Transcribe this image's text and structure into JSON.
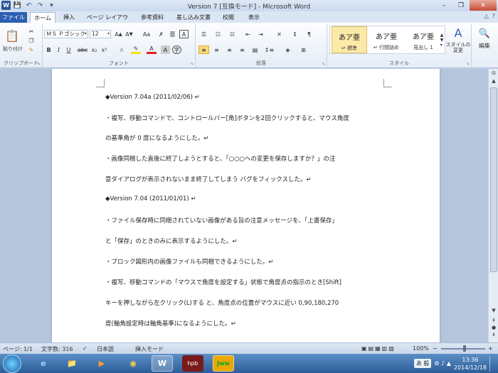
{
  "window": {
    "title": "Version 7 [互換モード] - Microsoft Word",
    "min_label": "–",
    "max_label": "❐",
    "close_label": "✕"
  },
  "tabs": [
    {
      "label": "ファイル"
    },
    {
      "label": "ホーム"
    },
    {
      "label": "挿入"
    },
    {
      "label": "ページ レイアウト"
    },
    {
      "label": "参考資料"
    },
    {
      "label": "差し込み文書"
    },
    {
      "label": "校閲"
    },
    {
      "label": "表示"
    }
  ],
  "ribbon": {
    "clipboard": {
      "label": "クリップボード",
      "paste_label": "貼り付け"
    },
    "font": {
      "label": "フォント",
      "font_name": "ＭＳ Ｐゴシック",
      "font_size": "12"
    },
    "paragraph": {
      "label": "段落"
    },
    "styles": {
      "label": "スタイル",
      "items": [
        {
          "sample": "あア亜",
          "name": "↵ 標準"
        },
        {
          "sample": "あア亜",
          "name": "↵ 行間詰め"
        },
        {
          "sample": "あア亜",
          "name": "見出し 1"
        }
      ],
      "change_label": "スタイルの変更"
    },
    "editing": {
      "label": "編集"
    }
  },
  "document": {
    "lines": [
      "◆Version 7.04a (2011/02/06) ↵",
      "・複写、移動コマンドで、コントロールバー[角]ボタンを2回クリックすると、マウス角度",
      "の基準角が 0 度になるようにした。↵",
      "・画像同梱した直後に終了しようとすると、「○○○への変更を保存しますか？」の注",
      "意ダイアログが表示されないまま終了してしまう バグをフィックスした。↵",
      "◆Version 7.04 (2011/01/01) ↵",
      "・ファイル保存時に同梱されていない画像がある旨の注意メッセージを、「上書保存」",
      "と「保存」のときのみに表示するようにした。↵",
      "・ブロック図形内の画像ファイルも同梱できるようにした。↵",
      "・複写、移動コマンドの「マウスで角度を設定する」状態で角度点の指示のとき[Shift]",
      "キーを押しながら左クリック(L)する と、角度点の位置がマウスに近い 0,90,180,270",
      "度(軸角設定時は軸角基準)になるようにした。↵"
    ]
  },
  "status": {
    "page": "ページ: 1/1",
    "words": "文字数: 316",
    "language": "日本語",
    "mode": "挿入モード",
    "zoom": "100%"
  },
  "taskbar": {
    "items": [
      {
        "label": "e"
      },
      {
        "label": "📁"
      },
      {
        "label": "▶"
      },
      {
        "label": "◉"
      },
      {
        "label": "W"
      },
      {
        "label": "hpb"
      },
      {
        "label": "Jww"
      }
    ],
    "ime": "あ 般",
    "time": "13:36",
    "date": "2014/12/18"
  }
}
